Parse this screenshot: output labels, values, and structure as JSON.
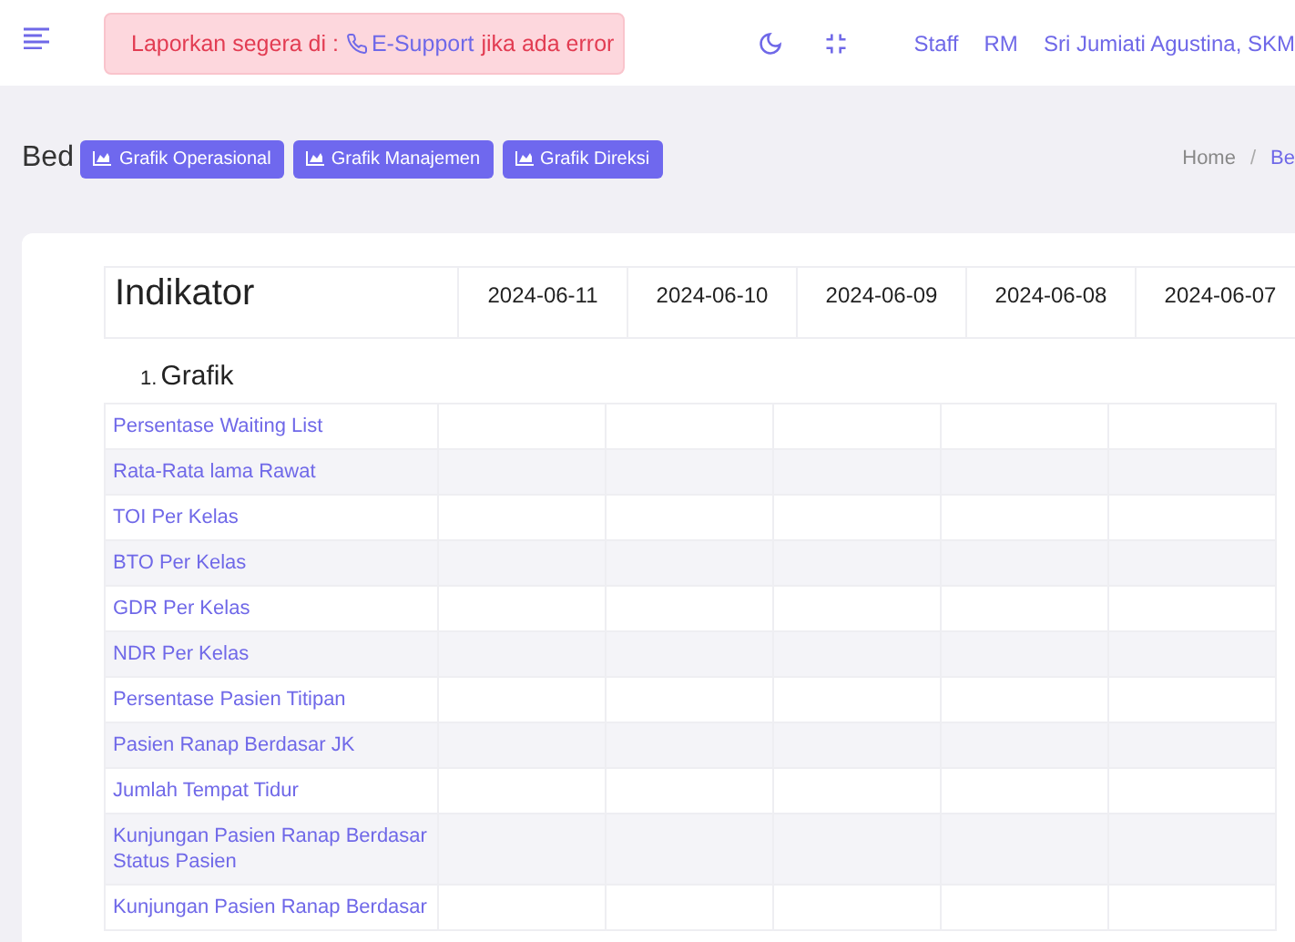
{
  "header": {
    "alert": {
      "before": "Laporkan segera di :",
      "link": "E-Support",
      "after": "jika ada error"
    },
    "nav_links": [
      "Staff",
      "RM",
      "Sri Jumiati Agustina, SKM"
    ]
  },
  "page": {
    "title": "Bed",
    "buttons": [
      "Grafik Operasional",
      "Grafik Manajemen",
      "Grafik Direksi"
    ],
    "breadcrumb": [
      "Home",
      "Be"
    ],
    "breadcrumb_separator": "/"
  },
  "table": {
    "columns": [
      "Indikator",
      "2024-06-11",
      "2024-06-10",
      "2024-06-09",
      "2024-06-08",
      "2024-06-07"
    ],
    "section": {
      "number": "1.",
      "title": "Grafik"
    },
    "rows": [
      "Persentase Waiting List",
      "Rata-Rata lama Rawat",
      "TOI Per Kelas",
      "BTO Per Kelas",
      "GDR Per Kelas",
      "NDR Per Kelas",
      "Persentase Pasien Titipan",
      "Pasien Ranap Berdasar JK",
      "Jumlah Tempat Tidur",
      "Kunjungan Pasien Ranap Berdasar Status Pasien",
      "Kunjungan Pasien Ranap Berdasar"
    ]
  }
}
